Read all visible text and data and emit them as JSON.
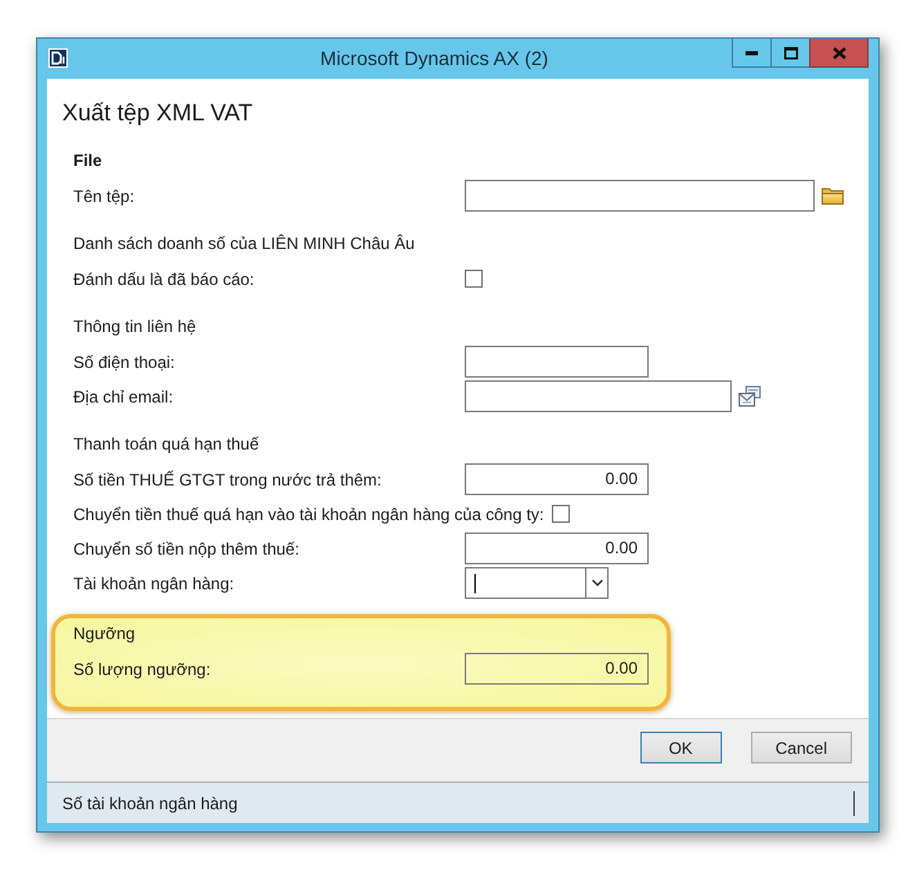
{
  "window": {
    "title": "Microsoft Dynamics AX (2)"
  },
  "form": {
    "title": "Xuất tệp XML VAT"
  },
  "groups": [
    {
      "heading": "File",
      "strong": true,
      "highlighted": false,
      "fields": [
        {
          "kind": "path",
          "label": "Tên tệp:"
        }
      ]
    },
    {
      "heading": "Danh sách doanh số của LIÊN MINH Châu Âu",
      "strong": false,
      "highlighted": false,
      "fields": [
        {
          "kind": "checkbox",
          "label": "Đánh dấu là đã báo cáo:",
          "checked": false
        }
      ]
    },
    {
      "heading": "Thông tin liên hệ",
      "strong": false,
      "highlighted": false,
      "fields": [
        {
          "kind": "text",
          "label": "Số điện thoại:"
        },
        {
          "kind": "email",
          "label": "Địa chỉ email:"
        }
      ]
    },
    {
      "heading": "Thanh toán quá hạn thuế",
      "strong": false,
      "highlighted": false,
      "fields": [
        {
          "kind": "amount",
          "label": "Số tiền THUẾ GTGT trong nước trả thêm:",
          "value": "0.00"
        },
        {
          "kind": "checkbox",
          "label": "Chuyển tiền thuế quá hạn vào tài khoản ngân hàng của công ty:",
          "checked": false
        },
        {
          "kind": "amount",
          "label": "Chuyển số tiền nộp thêm thuế:",
          "value": "0.00"
        },
        {
          "kind": "combo",
          "label": "Tài khoản ngân hàng:",
          "focused": true
        }
      ]
    },
    {
      "heading": "Ngưỡng",
      "strong": false,
      "highlighted": true,
      "fields": [
        {
          "kind": "amount",
          "label": "Số lượng ngưỡng:",
          "value": "0.00"
        }
      ]
    }
  ],
  "buttons": [
    {
      "label": "OK",
      "default": true
    },
    {
      "label": "Cancel",
      "default": false
    }
  ],
  "status_bar": {
    "text": "Số tài khoản ngân hàng"
  }
}
